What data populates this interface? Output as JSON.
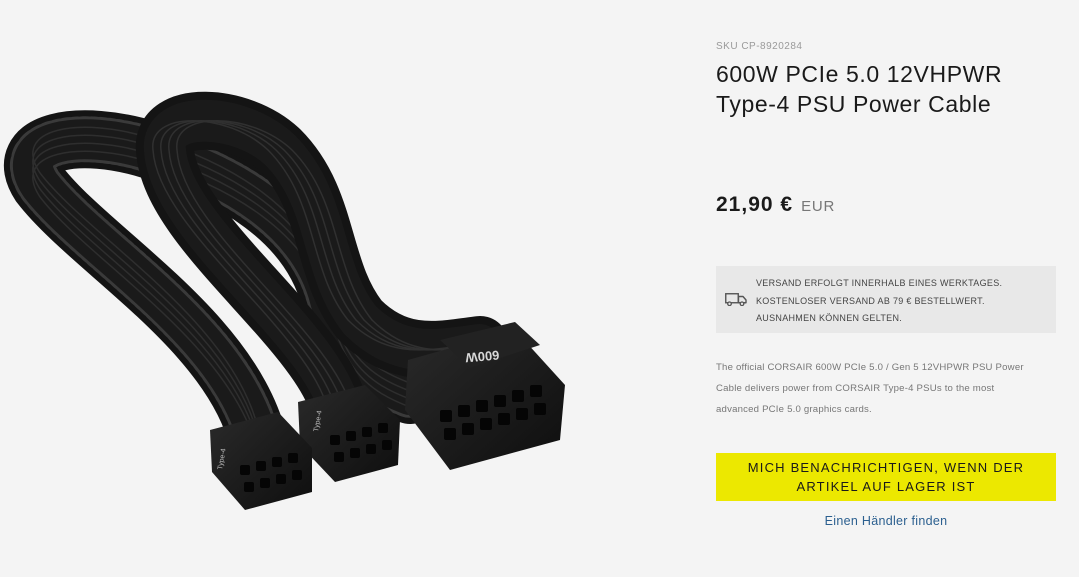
{
  "product": {
    "sku": "SKU CP-8920284",
    "title_line1": "600W PCIe 5.0 12VHPWR",
    "title_line2": "Type-4 PSU Power Cable",
    "price": "21,90 €",
    "currency": "EUR",
    "image_connector_label": "600W",
    "image_side_label": "Type-4"
  },
  "shipping": {
    "icon": "truck-icon",
    "lines": [
      "VERSAND ERFOLGT INNERHALB EINES WERKTAGES.",
      "KOSTENLOSER VERSAND AB 79 € BESTELLWERT.",
      "AUSNAHMEN KÖNNEN GELTEN."
    ]
  },
  "description": {
    "lines": [
      "The official CORSAIR 600W PCIe 5.0 / Gen 5 12VHPWR PSU Power",
      "Cable delivers power from CORSAIR Type-4 PSUs to the most",
      "advanced PCIe 5.0 graphics cards."
    ]
  },
  "actions": {
    "notify_line1": "MICH BENACHRICHTIGEN, WENN DER",
    "notify_line2": "ARTIKEL AUF LAGER IST",
    "dealer_link": "Einen Händler finden"
  },
  "colors": {
    "background": "#f4f4f4",
    "notify_button": "#ece800",
    "shipping_box": "#e8e8e8",
    "link": "#2b5f8f",
    "cable": "#1c1c1c"
  }
}
